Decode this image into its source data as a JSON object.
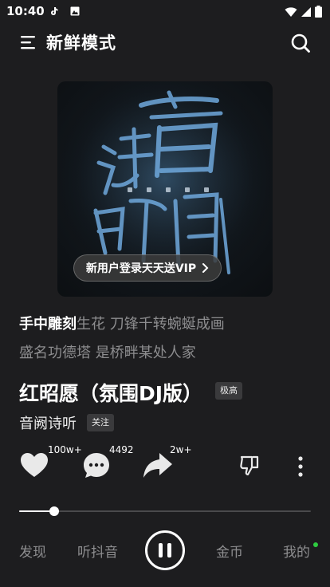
{
  "status_bar": {
    "time": "10:40",
    "left_icons": [
      "tiktok-icon",
      "image-icon"
    ],
    "right_icons": [
      "wifi-icon",
      "signal-icon",
      "battery-icon"
    ]
  },
  "header": {
    "title": "新鲜模式",
    "menu_icon": "menu-icon",
    "search_icon": "search-icon"
  },
  "cover": {
    "vip_label": "新用户登录天天送VIP"
  },
  "lyrics": {
    "line1_highlight": "手中雕刻",
    "line1_rest": "生花 刀锋千转蜿蜒成画",
    "line2": "盛名功德塔 是桥畔某处人家"
  },
  "song": {
    "title": "红昭愿（氛围DJ版）",
    "quality": "极高",
    "artist": "音阙诗听",
    "follow_label": "关注"
  },
  "actions": {
    "like_count": "100w+",
    "comment_count": "4492",
    "share_count": "2w+"
  },
  "progress": {
    "fraction": 0.12
  },
  "nav": {
    "discover": "发现",
    "listen": "听抖音",
    "coins": "金币",
    "mine": "我的",
    "mine_dot_color": "#2ecc40"
  }
}
